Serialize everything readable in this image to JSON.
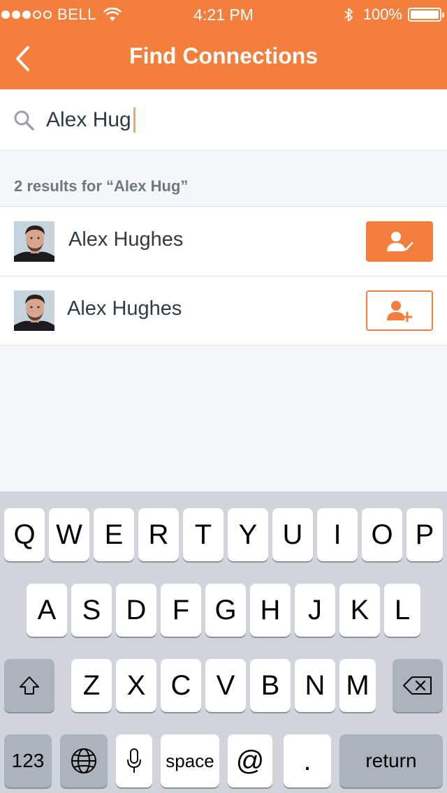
{
  "status": {
    "carrier": "BELL",
    "time": "4:21 PM",
    "battery": "100%",
    "signal_bars": 3,
    "signal_total": 5
  },
  "nav": {
    "title": "Find Connections",
    "back_icon": "chevron-left-icon"
  },
  "search": {
    "value": "Alex Hug",
    "icon": "search-icon"
  },
  "results": {
    "summary": "2 results for “Alex Hug”",
    "items": [
      {
        "name": "Alex Hughes",
        "status": "connected",
        "button_icon": "user-check-icon"
      },
      {
        "name": "Alex Hughes",
        "status": "not-connected",
        "button_icon": "user-add-icon"
      }
    ]
  },
  "keyboard": {
    "row1": [
      "Q",
      "W",
      "E",
      "R",
      "T",
      "Y",
      "U",
      "I",
      "O",
      "P"
    ],
    "row2": [
      "A",
      "S",
      "D",
      "F",
      "G",
      "H",
      "J",
      "K",
      "L"
    ],
    "row3": [
      "Z",
      "X",
      "C",
      "V",
      "B",
      "N",
      "M"
    ],
    "numbers_label": "123",
    "space_label": "space",
    "at_label": "@",
    "period_label": ".",
    "return_label": "return"
  },
  "colors": {
    "accent": "#f47e3c",
    "text_primary": "#2f3b45",
    "text_secondary": "#6f7780",
    "background": "#f5f6f8",
    "keyboard_bg": "#d1d5db"
  }
}
